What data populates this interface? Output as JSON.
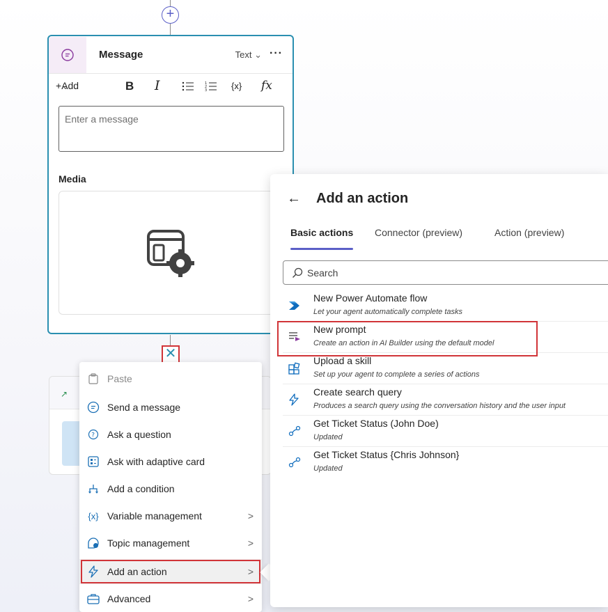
{
  "canvas": {
    "add_node_label": "+",
    "close_label": "✕"
  },
  "message_node": {
    "title": "Message",
    "type_selector": "Text",
    "more_label": "···",
    "toolbar": {
      "add_label": "Add",
      "bold_label": "B",
      "italic_label": "I"
    },
    "message_placeholder": "Enter a message",
    "media_label": "Media"
  },
  "context_menu": {
    "items": [
      {
        "label": "Paste",
        "icon": "paste-icon",
        "disabled": true,
        "has_submenu": false
      },
      {
        "label": "Send a message",
        "icon": "chat-bubble-icon",
        "disabled": false,
        "has_submenu": false
      },
      {
        "label": "Ask a question",
        "icon": "question-bubble-icon",
        "disabled": false,
        "has_submenu": false
      },
      {
        "label": "Ask with adaptive card",
        "icon": "adaptive-card-icon",
        "disabled": false,
        "has_submenu": false
      },
      {
        "label": "Add a condition",
        "icon": "branch-icon",
        "disabled": false,
        "has_submenu": false
      },
      {
        "label": "Variable management",
        "icon": "variable-icon",
        "disabled": false,
        "has_submenu": true
      },
      {
        "label": "Topic management",
        "icon": "topic-icon",
        "disabled": false,
        "has_submenu": true
      },
      {
        "label": "Add an action",
        "icon": "lightning-icon",
        "disabled": false,
        "has_submenu": true,
        "selected": true
      },
      {
        "label": "Advanced",
        "icon": "toolbox-icon",
        "disabled": false,
        "has_submenu": true
      }
    ]
  },
  "action_panel": {
    "back_label": "←",
    "title": "Add an action",
    "tabs": [
      {
        "label": "Basic actions",
        "active": true
      },
      {
        "label": "Connector (preview)",
        "active": false
      },
      {
        "label": "Action (preview)",
        "active": false
      }
    ],
    "search_placeholder": "Search",
    "actions": [
      {
        "name": "New Power Automate flow",
        "description": "Let your agent automatically complete tasks",
        "icon": "power-automate-icon"
      },
      {
        "name": "New prompt",
        "description": "Create an action in AI Builder using the default model",
        "icon": "prompt-icon",
        "highlighted": true
      },
      {
        "name": "Upload a skill",
        "description": "Set up your agent to complete a series of actions",
        "icon": "skill-icon"
      },
      {
        "name": "Create search query",
        "description": "Produces a search query using the conversation history and the user input",
        "icon": "lightning-icon"
      },
      {
        "name": "Get Ticket Status (John Doe)",
        "description": "Updated",
        "icon": "connector-icon"
      },
      {
        "name": "Get Ticket Status {Chris Johnson}",
        "description": "Updated",
        "icon": "connector-icon"
      }
    ]
  },
  "colors": {
    "accent": "#5b5fc7",
    "node_border": "#2a8fb0",
    "highlight_red": "#d13438"
  }
}
